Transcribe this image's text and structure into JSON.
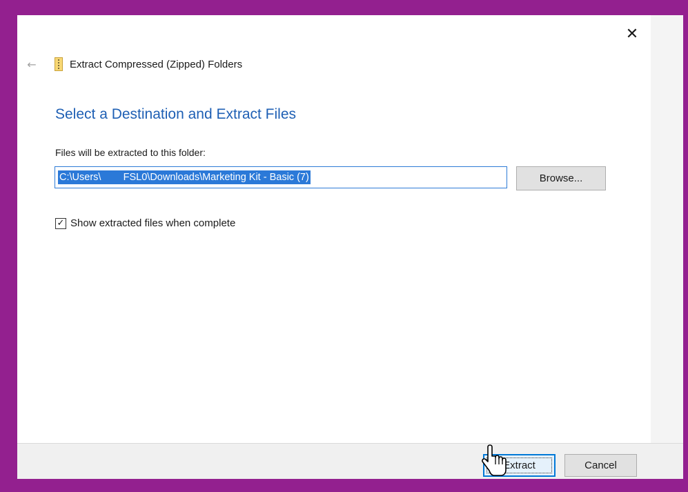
{
  "window": {
    "title": "Extract Compressed (Zipped) Folders",
    "close_glyph": "✕",
    "back_glyph": "←"
  },
  "main": {
    "heading": "Select a Destination and Extract Files",
    "folder_label": "Files will be extracted to this folder:",
    "path_value": "C:\\Users\\        FSL0\\Downloads\\Marketing Kit - Basic (7)",
    "browse_label": "Browse...",
    "checkbox_checked": true,
    "checkbox_glyph": "✓",
    "checkbox_label": "Show extracted files when complete"
  },
  "footer": {
    "extract_label": "Extract",
    "cancel_label": "Cancel"
  },
  "icons": {
    "close": "close-icon",
    "back": "back-arrow-icon",
    "zip": "zip-folder-icon",
    "cursor": "hand-cursor-icon"
  },
  "colors": {
    "frame": "#93208f",
    "accent": "#0078d7",
    "heading": "#1e5fb4",
    "selection": "#2b79d8"
  }
}
